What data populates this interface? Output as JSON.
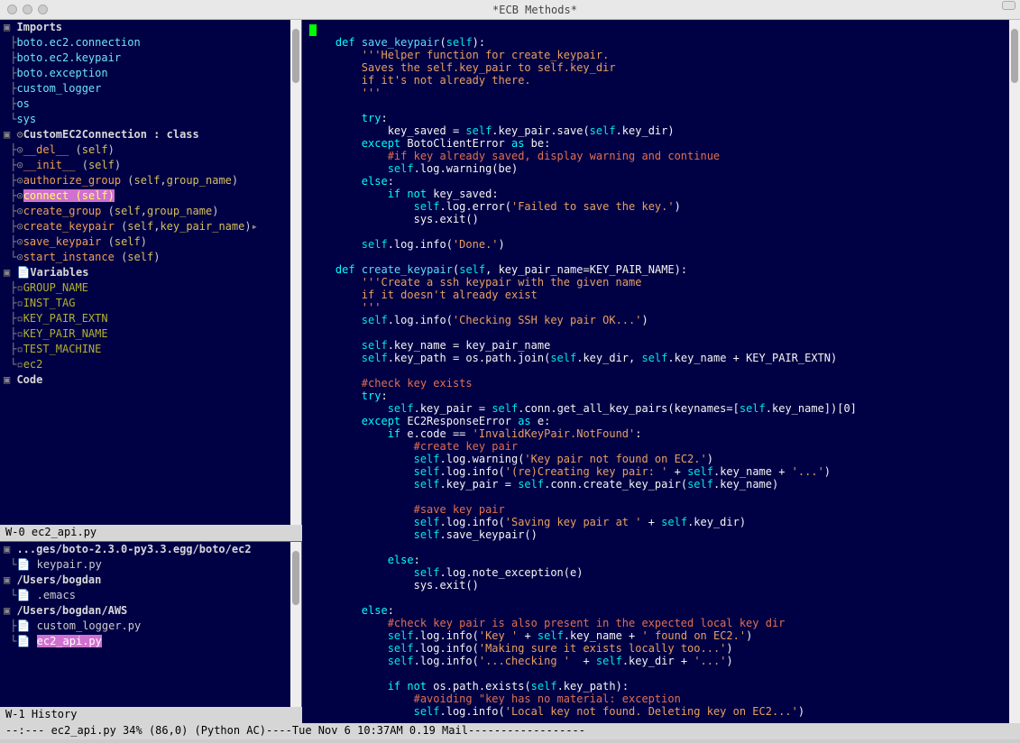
{
  "window": {
    "title": "*ECB Methods*"
  },
  "methods": {
    "imports_header": "Imports",
    "imports": [
      "boto.ec2.connection",
      "boto.ec2.keypair",
      "boto.exception",
      "custom_logger",
      "os",
      "sys"
    ],
    "class_header": "CustomEC2Connection : class",
    "class_methods": {
      "del": {
        "name": "__del__",
        "params_open": " (",
        "self": "self",
        "close": ")"
      },
      "init": {
        "name": "__init__",
        "params_open": " (",
        "self": "self",
        "close": ")"
      },
      "auth": {
        "name": "authorize_group",
        "params_open": " (",
        "self": "self",
        "comma": ",",
        "p2": "group_name",
        "close": ")"
      },
      "connect": {
        "name": "connect ",
        "open": "(",
        "self": "self",
        "close": ")"
      },
      "cgroup": {
        "name": "create_group",
        "params_open": " (",
        "self": "self",
        "comma": ",",
        "p2": "group_name",
        "close": ")"
      },
      "ckp": {
        "name": "create_keypair",
        "params_open": " (",
        "self": "self",
        "comma": ",",
        "p2": "key_pair_name",
        "close": ")"
      },
      "skp": {
        "name": "save_keypair",
        "params_open": " (",
        "self": "self",
        "close": ")"
      },
      "start": {
        "name": "start_instance",
        "params_open": " (",
        "self": "self",
        "close": ")"
      }
    },
    "vars_header": "Variables",
    "vars": [
      "GROUP_NAME",
      "INST_TAG",
      "KEY_PAIR_EXTN",
      "KEY_PAIR_NAME",
      "TEST_MACHINE",
      "ec2"
    ],
    "code_header": "Code"
  },
  "history": {
    "path1": "...ges/boto-2.3.0-py3.3.egg/boto/ec2",
    "file1": "keypair.py",
    "path2": "/Users/bogdan",
    "file2": ".emacs",
    "path3": "/Users/bogdan/AWS",
    "file3": "custom_logger.py",
    "file4": "ec2_api.py"
  },
  "modelines": {
    "w0": "W-0  ec2_api.py",
    "w1": "W-1  History",
    "main": "--:---  ec2_api.py    34% (86,0)    (Python AC)----Tue Nov   6 10:37AM 0.19 Mail------------------"
  },
  "code": {
    "l01a": "    ",
    "l01b": "def",
    "l01c": " ",
    "l01d": "save_keypair",
    "l01e": "(",
    "l01f": "self",
    "l01g": "):",
    "l02": "        '''Helper function for create_keypair.",
    "l03": "        Saves the self.key_pair to self.key_dir",
    "l04": "        if it's not already there.",
    "l05": "        '''",
    "l07a": "        ",
    "l07b": "try",
    "l07c": ":",
    "l08a": "            key_saved = ",
    "l08b": "self",
    "l08c": ".key_pair.save(",
    "l08d": "self",
    "l08e": ".key_dir)",
    "l09a": "        ",
    "l09b": "except",
    "l09c": " BotoClientError ",
    "l09d": "as",
    "l09e": " be:",
    "l10": "            #if key already saved, display warning and continue",
    "l11a": "            ",
    "l11b": "self",
    "l11c": ".log.warning(be)",
    "l12a": "        ",
    "l12b": "else",
    "l12c": ":",
    "l13a": "            ",
    "l13b": "if",
    "l13c": " ",
    "l13d": "not",
    "l13e": " key_saved:",
    "l14a": "                ",
    "l14b": "self",
    "l14c": ".log.error(",
    "l14d": "'Failed to save the key.'",
    "l14e": ")",
    "l15": "                sys.exit()",
    "l17a": "        ",
    "l17b": "self",
    "l17c": ".log.info(",
    "l17d": "'Done.'",
    "l17e": ")",
    "l19a": "    ",
    "l19b": "def",
    "l19c": " ",
    "l19d": "create_keypair",
    "l19e": "(",
    "l19f": "self",
    "l19g": ", key_pair_name=KEY_PAIR_NAME):",
    "l20": "        '''Create a ssh keypair with the given name",
    "l21": "        if it doesn't already exist",
    "l22": "        '''",
    "l23a": "        ",
    "l23b": "self",
    "l23c": ".log.info(",
    "l23d": "'Checking SSH key pair OK...'",
    "l23e": ")",
    "l25a": "        ",
    "l25b": "self",
    "l25c": ".key_name = key_pair_name",
    "l26a": "        ",
    "l26b": "self",
    "l26c": ".key_path = os.path.join(",
    "l26d": "self",
    "l26e": ".key_dir, ",
    "l26f": "self",
    "l26g": ".key_name + KEY_PAIR_EXTN)",
    "l28": "        #check key exists",
    "l29a": "        ",
    "l29b": "try",
    "l29c": ":",
    "l30a": "            ",
    "l30b": "self",
    "l30c": ".key_pair = ",
    "l30d": "self",
    "l30e": ".conn.get_all_key_pairs(keynames=[",
    "l30f": "self",
    "l30g": ".key_name])[0]",
    "l31a": "        ",
    "l31b": "except",
    "l31c": " EC2ResponseError ",
    "l31d": "as",
    "l31e": " e:",
    "l32a": "            ",
    "l32b": "if",
    "l32c": " e.code == ",
    "l32d": "'InvalidKeyPair.NotFound'",
    "l32e": ":",
    "l33": "                #create key pair",
    "l34a": "                ",
    "l34b": "self",
    "l34c": ".log.warning(",
    "l34d": "'Key pair not found on EC2.'",
    "l34e": ")",
    "l35a": "                ",
    "l35b": "self",
    "l35c": ".log.info(",
    "l35d": "'(re)Creating key pair: '",
    "l35e": " + ",
    "l35f": "self",
    "l35g": ".key_name + ",
    "l35h": "'...'",
    "l35i": ")",
    "l36a": "                ",
    "l36b": "self",
    "l36c": ".key_pair = ",
    "l36d": "self",
    "l36e": ".conn.create_key_pair(",
    "l36f": "self",
    "l36g": ".key_name)",
    "l38": "                #save key pair",
    "l39a": "                ",
    "l39b": "self",
    "l39c": ".log.info(",
    "l39d": "'Saving key pair at '",
    "l39e": " + ",
    "l39f": "self",
    "l39g": ".key_dir)",
    "l40a": "                ",
    "l40b": "self",
    "l40c": ".save_keypair()",
    "l42a": "            ",
    "l42b": "else",
    "l42c": ":",
    "l43a": "                ",
    "l43b": "self",
    "l43c": ".log.note_exception(e)",
    "l44": "                sys.exit()",
    "l46a": "        ",
    "l46b": "else",
    "l46c": ":",
    "l47": "            #check key pair is also present in the expected local key dir",
    "l48a": "            ",
    "l48b": "self",
    "l48c": ".log.info(",
    "l48d": "'Key '",
    "l48e": " + ",
    "l48f": "self",
    "l48g": ".key_name + ",
    "l48h": "' found on EC2.'",
    "l48i": ")",
    "l49a": "            ",
    "l49b": "self",
    "l49c": ".log.info(",
    "l49d": "'Making sure it exists locally too...'",
    "l49e": ")",
    "l50a": "            ",
    "l50b": "self",
    "l50c": ".log.info(",
    "l50d": "'...checking '",
    "l50e": "  + ",
    "l50f": "self",
    "l50g": ".key_dir + ",
    "l50h": "'...'",
    "l50i": ")",
    "l52a": "            ",
    "l52b": "if",
    "l52c": " ",
    "l52d": "not",
    "l52e": " os.path.exists(",
    "l52f": "self",
    "l52g": ".key_path):",
    "l53": "                #avoiding \"key has no material: exception",
    "l54a": "                ",
    "l54b": "self",
    "l54c": ".log.info(",
    "l54d": "'Local key not found. Deleting key on EC2...'",
    "l54e": ")"
  }
}
